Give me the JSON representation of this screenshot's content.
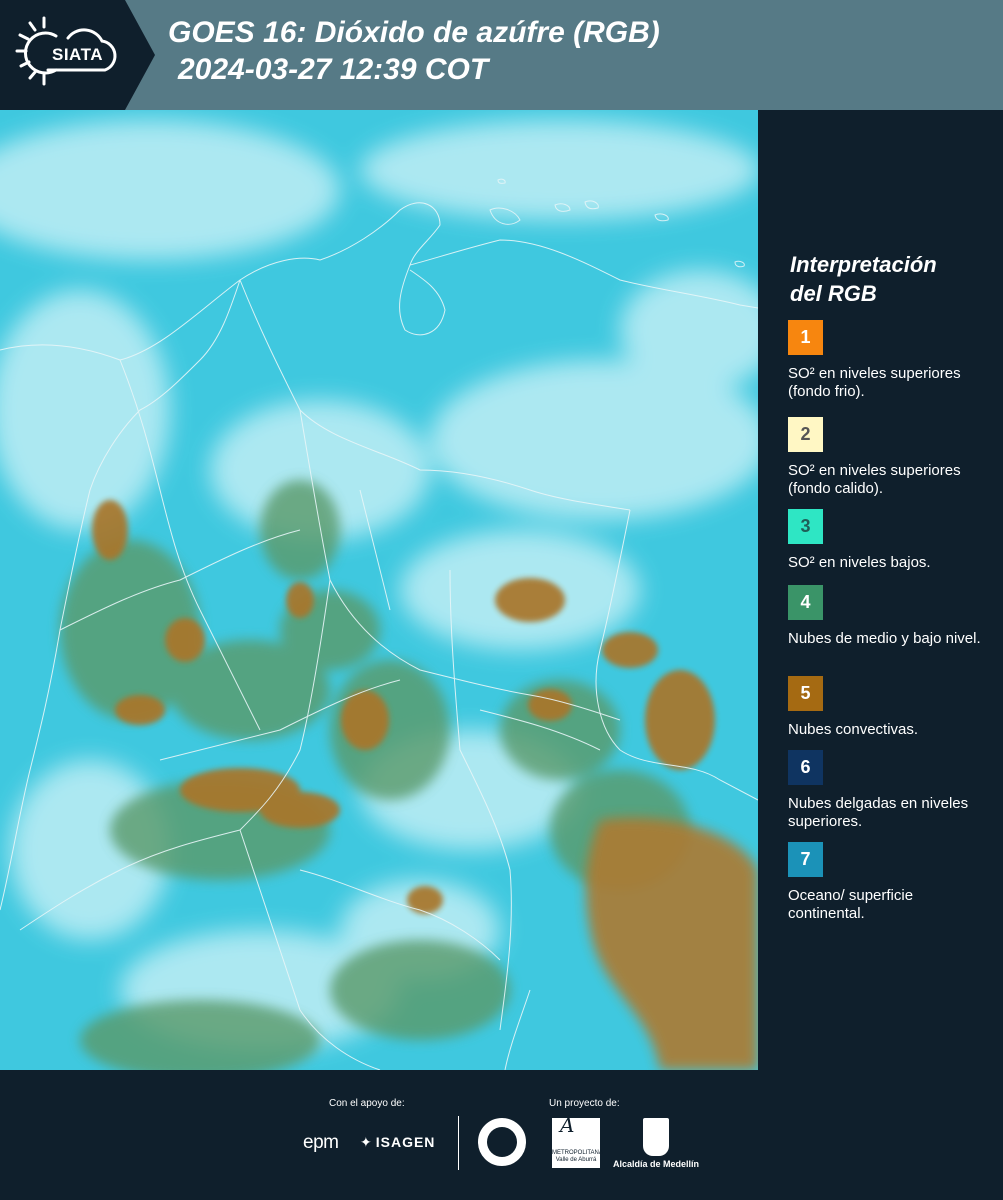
{
  "header": {
    "logo_text": "SIATA",
    "title_line1": "GOES 16: Dióxido de azúfre (RGB)",
    "title_line2": "2024-03-27 12:39 COT"
  },
  "legend": {
    "title_line1": "Interpretación",
    "title_line2": "del RGB",
    "items": [
      {
        "number": "1",
        "color": "#f7860f",
        "text_color": "#ffffff",
        "label": "SO² en niveles superiores (fondo frio)."
      },
      {
        "number": "2",
        "color": "#fff7c4",
        "text_color": "#555555",
        "label": "SO² en niveles superiores (fondo calido)."
      },
      {
        "number": "3",
        "color": "#2ee6c4",
        "text_color": "#1f5f58",
        "label": "SO² en niveles bajos."
      },
      {
        "number": "4",
        "color": "#3a9468",
        "text_color": "#ffffff",
        "label": "Nubes de medio y bajo nivel."
      },
      {
        "number": "5",
        "color": "#a56a12",
        "text_color": "#ffffff",
        "label": "Nubes convectivas."
      },
      {
        "number": "6",
        "color": "#0f3461",
        "text_color": "#ffffff",
        "label": "Nubes delgadas en niveles superiores."
      },
      {
        "number": "7",
        "color": "#1b92b8",
        "text_color": "#ffffff",
        "label": "Oceano/ superficie continental."
      }
    ]
  },
  "footer": {
    "support_label": "Con el apoyo de:",
    "project_label": "Un proyecto de:",
    "epm": "epm",
    "isagen": "ISAGEN",
    "metro_name": "METROPOLITANA",
    "metro_sub": "Valle de Aburrá",
    "alcaldia": "Alcaldía de Medellín"
  },
  "colors": {
    "header_bg": "#567a86",
    "panel_bg": "#0f1f2c",
    "map_cyan": "#3fc8df",
    "map_cloud": "#bfeef5",
    "map_convective": "#a9762a",
    "map_green": "#5a9a6a"
  }
}
